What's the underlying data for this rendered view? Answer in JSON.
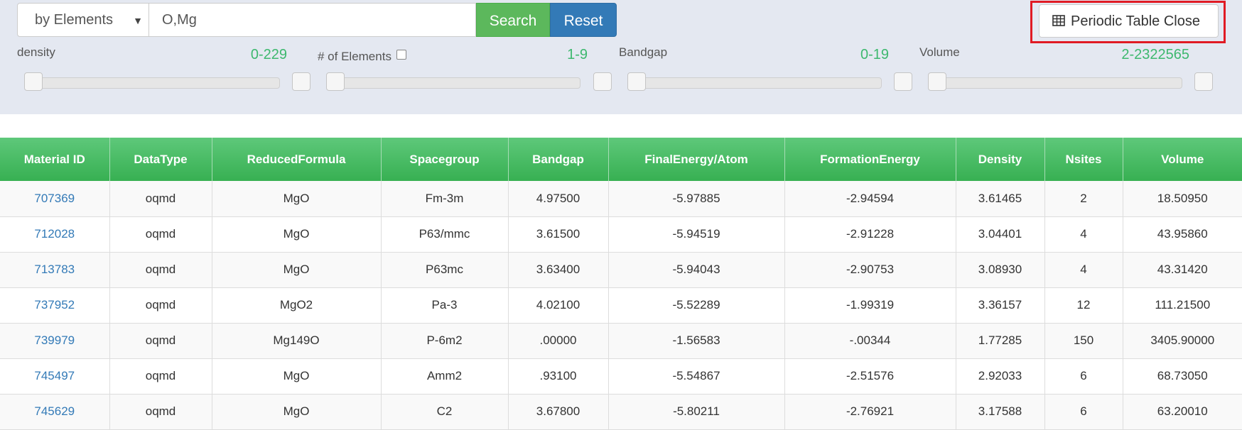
{
  "search": {
    "mode": "by Elements",
    "query": "O,Mg",
    "search_label": "Search",
    "reset_label": "Reset"
  },
  "periodic_button": {
    "label": "Periodic Table Close",
    "icon": "table-icon"
  },
  "filters": [
    {
      "label": "density",
      "range": "0-229",
      "has_checkbox": false
    },
    {
      "label": "# of Elements",
      "range": "1-9",
      "has_checkbox": true
    },
    {
      "label": "Bandgap",
      "range": "0-19",
      "has_checkbox": false
    },
    {
      "label": "Volume",
      "range": "2-2322565",
      "has_checkbox": false
    }
  ],
  "table": {
    "columns": [
      "Material ID",
      "DataType",
      "ReducedFormula",
      "Spacegroup",
      "Bandgap",
      "FinalEnergy/Atom",
      "FormationEnergy",
      "Density",
      "Nsites",
      "Volume"
    ],
    "rows": [
      [
        "707369",
        "oqmd",
        "MgO",
        "Fm-3m",
        "4.97500",
        "-5.97885",
        "-2.94594",
        "3.61465",
        "2",
        "18.50950"
      ],
      [
        "712028",
        "oqmd",
        "MgO",
        "P63/mmc",
        "3.61500",
        "-5.94519",
        "-2.91228",
        "3.04401",
        "4",
        "43.95860"
      ],
      [
        "713783",
        "oqmd",
        "MgO",
        "P63mc",
        "3.63400",
        "-5.94043",
        "-2.90753",
        "3.08930",
        "4",
        "43.31420"
      ],
      [
        "737952",
        "oqmd",
        "MgO2",
        "Pa-3",
        "4.02100",
        "-5.52289",
        "-1.99319",
        "3.36157",
        "12",
        "111.21500"
      ],
      [
        "739979",
        "oqmd",
        "Mg149O",
        "P-6m2",
        ".00000",
        "-1.56583",
        "-.00344",
        "1.77285",
        "150",
        "3405.90000"
      ],
      [
        "745497",
        "oqmd",
        "MgO",
        "Amm2",
        ".93100",
        "-5.54867",
        "-2.51576",
        "2.92033",
        "6",
        "68.73050"
      ],
      [
        "745629",
        "oqmd",
        "MgO",
        "C2",
        "3.67800",
        "-5.80211",
        "-2.76921",
        "3.17588",
        "6",
        "63.20010"
      ]
    ]
  }
}
